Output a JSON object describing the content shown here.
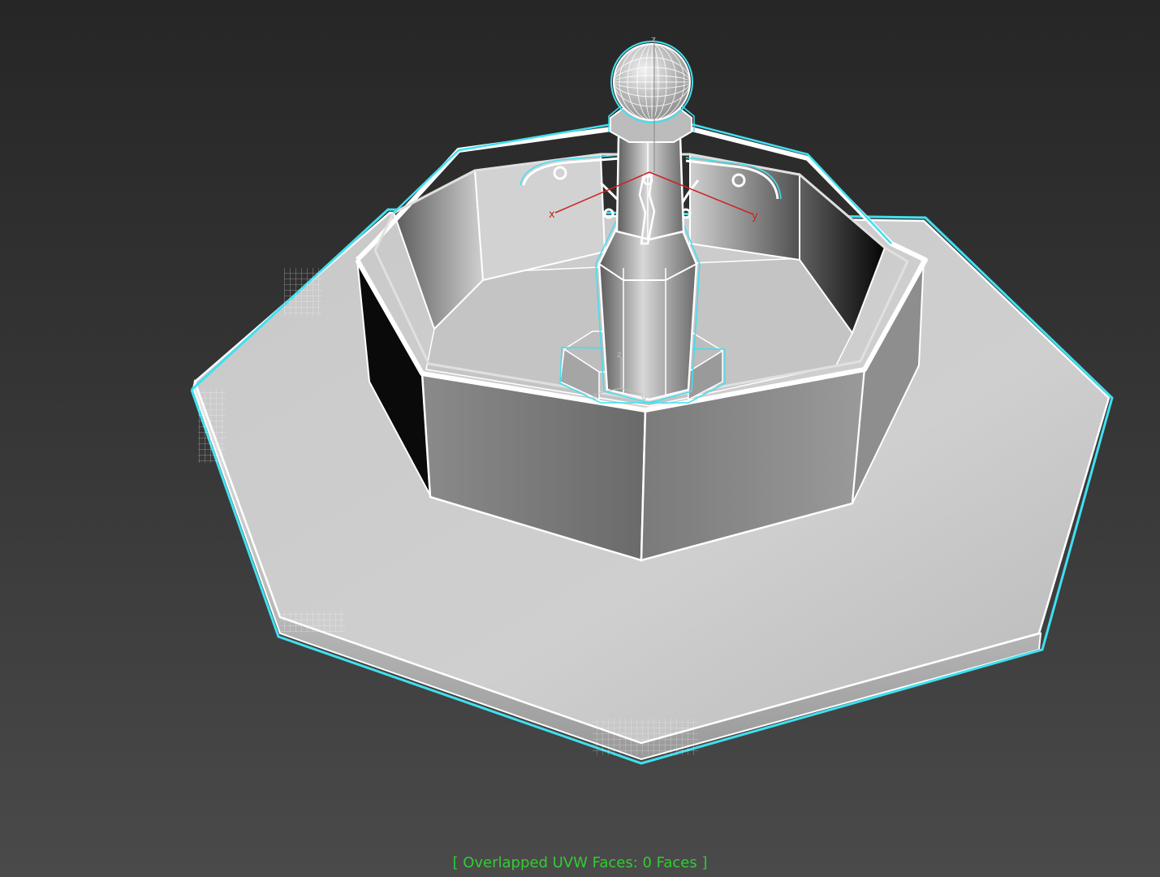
{
  "viewport": {
    "background_top": "#262626",
    "background_bottom": "#4a4a4a"
  },
  "status": {
    "readout": "[ Overlapped UVW Faces: 0 Faces ]",
    "color": "#33cc33"
  },
  "selection": {
    "outline_color": "#40e0f0",
    "wire_color": "#ffffff"
  },
  "gizmo": {
    "axis_color": "#cc2222",
    "labels": {
      "x": "x",
      "y": "y",
      "z": "z"
    }
  },
  "icons": {
    "transform_gizmo": "tripod-axis-icon",
    "pivot": "pivot-axis-icon"
  }
}
